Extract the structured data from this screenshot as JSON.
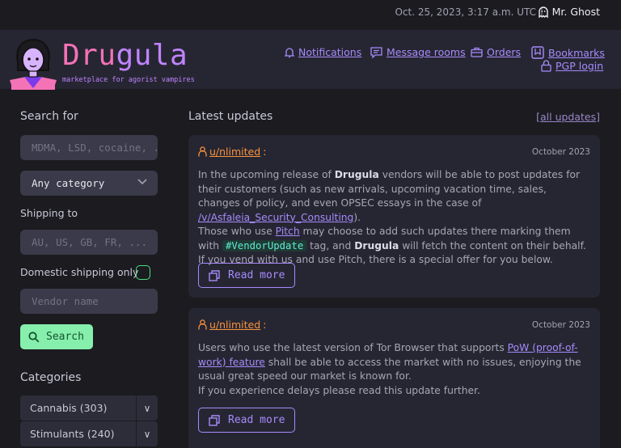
{
  "topbar": {
    "datetime": "Oct. 25, 2023, 3:17 a.m. UTC",
    "separator": "|",
    "username": "Mr. Ghost",
    "user_icon": "ghost-icon"
  },
  "header": {
    "brand_part1": "Dru",
    "brand_part2": "gula",
    "tagline": "marketplace for agorist vampires",
    "nav": {
      "notifications": "Notifications",
      "message_rooms": "Message rooms",
      "orders": "Orders",
      "bookmarks": "Bookmarks",
      "pgp_login": "PGP login"
    }
  },
  "sidebar": {
    "search_title": "Search for",
    "search_placeholder": "MDMA, LSD, cocaine, ...",
    "category_select": "Any category",
    "shipping_label": "Shipping to",
    "shipping_placeholder": "AU, US, GB, FR, ...",
    "domestic_label": "Domestic shipping only",
    "vendor_placeholder": "Vendor name",
    "search_button": "Search",
    "categories_title": "Categories",
    "categories": [
      {
        "label": "Cannabis (303)",
        "toggle": "∨"
      },
      {
        "label": "Stimulants (240)",
        "toggle": "∨"
      }
    ]
  },
  "main": {
    "title": "Latest updates",
    "all_updates": "[all updates]",
    "posts": [
      {
        "author": "u/nlimited",
        "author_suffix": ":",
        "date": "October 2023",
        "read_more": "Read more"
      },
      {
        "author": "u/nlimited",
        "author_suffix": ":",
        "date": "October 2023",
        "read_more": "Read more"
      }
    ],
    "post1": {
      "t1": "In the upcoming release of ",
      "b1": "Drugula",
      "t2": " vendors will be able to post updates for their customers (such as new arrivals, upcoming vacation time, sales, changes of policy, and even OPSEC essays in the case of ",
      "link1": "/v/Asfaleia_Security_Consulting",
      "t3": ").",
      "t4": "Those who use ",
      "link2": "Pitch",
      "t5": " may choose to add such updates there marking them with ",
      "tag": "#VendorUpdate",
      "t6": " tag, and ",
      "b2": "Drugula",
      "t7": " will fetch the content on their behalf. If you vend with us and use Pitch, there is a special offer for you below."
    },
    "post2": {
      "t1": "Users who use the latest version of Tor Browser that supports ",
      "link1": "PoW (proof-of-work) feature",
      "t2": " shall be able to access the market with no issues, enjoying the usual great speed our market is known for.",
      "t3": "If you experience delays please read this update further."
    }
  },
  "colors": {
    "brand_pink": "#f472b6",
    "brand_purple": "#c084fc",
    "link": "#a78bfa",
    "search_button": "#86efac",
    "author": "#fb923c",
    "tag": "#5eead4"
  }
}
